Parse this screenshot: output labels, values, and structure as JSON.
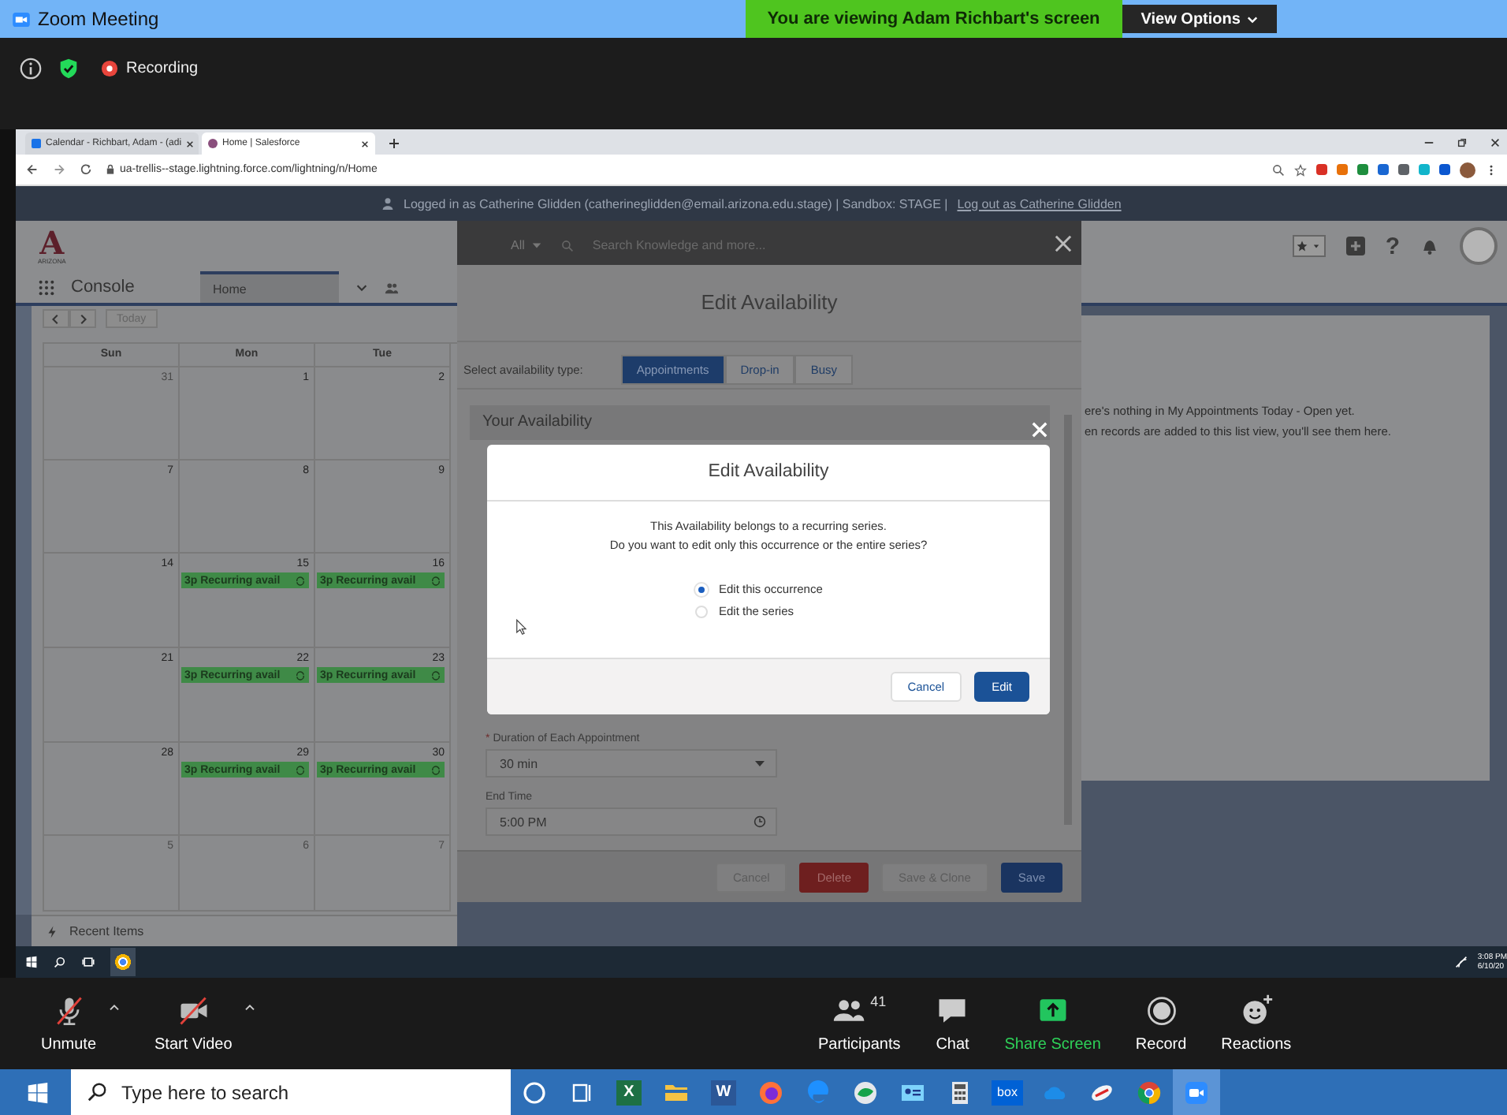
{
  "zoom_window": {
    "title": "Zoom Meeting",
    "banner": "You are viewing Adam Richbart's screen",
    "view_options": "View Options",
    "recording": "Recording"
  },
  "browser": {
    "tabs": [
      {
        "label": "Calendar - Richbart, Adam - (adi",
        "selected": false
      },
      {
        "label": "Home | Salesforce",
        "selected": true
      }
    ],
    "address": "ua-trellis--stage.lightning.force.com/lightning/n/Home"
  },
  "salesforce": {
    "login_text": "Logged in as Catherine Glidden (catherineglidden@email.arizona.edu.stage) | Sandbox: STAGE |",
    "logout_link": "Log out as Catherine Glidden",
    "logo_letter": "A",
    "logo_caption": "ARIZONA",
    "app_name": "Console",
    "nav_tab": "Home",
    "help_glyph": "?",
    "calendar": {
      "today_button": "Today",
      "weekdays": [
        "Sun",
        "Mon",
        "Tue"
      ],
      "weeks": [
        [
          {
            "day": "31",
            "muted": true
          },
          {
            "day": "1",
            "muted": false
          },
          {
            "day": "2",
            "muted": false
          }
        ],
        [
          {
            "day": "7",
            "muted": false
          },
          {
            "day": "8",
            "muted": false
          },
          {
            "day": "9",
            "muted": false
          }
        ],
        [
          {
            "day": "14",
            "muted": false
          },
          {
            "day": "15",
            "muted": false,
            "event": "3p Recurring avail"
          },
          {
            "day": "16",
            "muted": false,
            "event": "3p Recurring avail"
          }
        ],
        [
          {
            "day": "21",
            "muted": false
          },
          {
            "day": "22",
            "muted": false,
            "event": "3p Recurring avail"
          },
          {
            "day": "23",
            "muted": false,
            "event": "3p Recurring avail"
          }
        ],
        [
          {
            "day": "28",
            "muted": false
          },
          {
            "day": "29",
            "muted": false,
            "event": "3p Recurring avail"
          },
          {
            "day": "30",
            "muted": false,
            "event": "3p Recurring avail"
          }
        ],
        [
          {
            "day": "5",
            "muted": true
          },
          {
            "day": "6",
            "muted": true
          },
          {
            "day": "7",
            "muted": true
          }
        ]
      ]
    },
    "empty_lines": [
      "ere's nothing in My Appointments Today - Open yet.",
      "en records are added to this list view, you'll see them here."
    ],
    "recent_items": "Recent Items"
  },
  "edit_panel": {
    "search_scope": "All",
    "search_placeholder": "Search Knowledge and more...",
    "title": "Edit Availability",
    "type_label": "Select availability type:",
    "types": [
      {
        "label": "Appointments",
        "selected": true
      },
      {
        "label": "Drop-in",
        "selected": false
      },
      {
        "label": "Busy",
        "selected": false
      }
    ],
    "section": "Your Availability",
    "required_mark": "*",
    "duration_label": "Duration of Each Appointment",
    "duration_value": "30 min",
    "end_time_label": "End Time",
    "end_time_value": "5:00 PM",
    "buttons": [
      {
        "label": "Cancel",
        "kind": "neutral"
      },
      {
        "label": "Delete",
        "kind": "destructive"
      },
      {
        "label": "Save & Clone",
        "kind": "neutral"
      },
      {
        "label": "Save",
        "kind": "brand"
      }
    ]
  },
  "dialog": {
    "title": "Edit Availability",
    "message_lines": [
      "This Availability belongs to a recurring series.",
      "Do you want to edit only this occurrence or the entire series?"
    ],
    "options": [
      {
        "label": "Edit this occurrence",
        "selected": true
      },
      {
        "label": "Edit the series",
        "selected": false
      }
    ],
    "buttons": [
      {
        "label": "Cancel",
        "kind": "neutral"
      },
      {
        "label": "Edit",
        "kind": "brand"
      }
    ]
  },
  "remote_taskbar": {
    "time": "3:08 PM",
    "date": "6/10/20"
  },
  "meeting_controls": [
    {
      "label": "Unmute",
      "kind": "mic-off"
    },
    {
      "label": "Start Video",
      "kind": "video-off"
    },
    {
      "label": "Participants",
      "kind": "participants",
      "count": "41"
    },
    {
      "label": "Chat",
      "kind": "chat"
    },
    {
      "label": "Share Screen",
      "kind": "share"
    },
    {
      "label": "Record",
      "kind": "record"
    },
    {
      "label": "Reactions",
      "kind": "reactions"
    }
  ],
  "taskbar": {
    "search_placeholder": "Type here to search",
    "apps": [
      {
        "kind": "cortana",
        "active": false
      },
      {
        "kind": "task-view",
        "active": false
      },
      {
        "kind": "excel",
        "letter": "X",
        "active": false
      },
      {
        "kind": "explorer",
        "active": false
      },
      {
        "kind": "word",
        "letter": "W",
        "active": false
      },
      {
        "kind": "firefox",
        "active": false
      },
      {
        "kind": "edge",
        "active": false
      },
      {
        "kind": "globe",
        "active": false
      },
      {
        "kind": "contacts",
        "active": false
      },
      {
        "kind": "calculator",
        "active": false
      },
      {
        "kind": "box",
        "letter": "box",
        "active": false
      },
      {
        "kind": "onedrive",
        "active": false
      },
      {
        "kind": "app",
        "active": false
      },
      {
        "kind": "chrome",
        "active": false
      },
      {
        "kind": "zoom",
        "active": true
      }
    ]
  }
}
